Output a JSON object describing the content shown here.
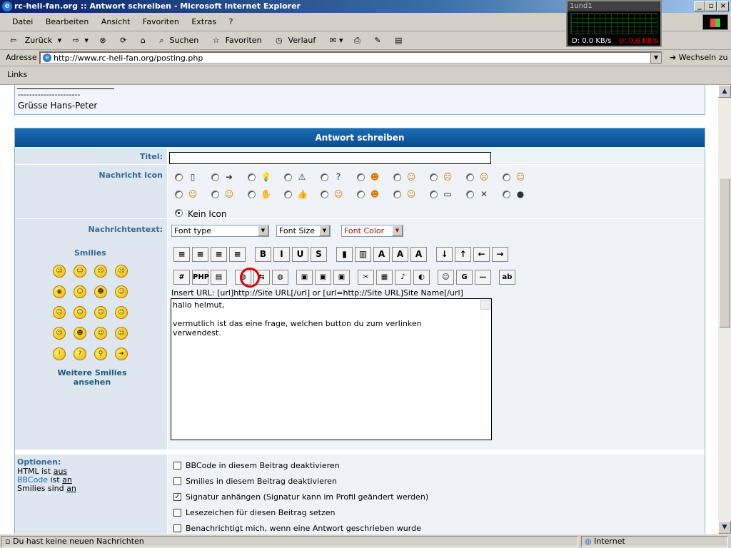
{
  "window": {
    "title": "rc-heli-fan.org :: Antwort schreiben - Microsoft Internet Explorer"
  },
  "net_meter": {
    "title": "1und1",
    "download": "D: 0,0 KB/s",
    "upload": "U: 0,0 KB/s"
  },
  "menu": [
    "Datei",
    "Bearbeiten",
    "Ansicht",
    "Favoriten",
    "Extras",
    "?"
  ],
  "toolbar": {
    "back": "Zurück",
    "search": "Suchen",
    "favorites": "Favoriten",
    "history": "Verlauf"
  },
  "address": {
    "label": "Adresse",
    "url": "http://www.rc-heli-fan.org/posting.php",
    "go": "Wechseln zu"
  },
  "links": {
    "label": "Links"
  },
  "post": {
    "divider": "----------------------",
    "greeting": "Grüsse Hans-Peter"
  },
  "form": {
    "header": "Antwort schreiben",
    "title_label": "Titel:",
    "icon_label": "Nachricht Icon",
    "no_icon": "Kein Icon",
    "text_label": "Nachrichtentext:",
    "font_type": "Font type",
    "font_size": "Font Size",
    "font_color": "Font Color",
    "smilies_heading": "Smilies",
    "more_smilies": "Weitere Smilies ansehen",
    "url_hint": "Insert URL: [url]http://Site URL[/url] or [url=http://Site URL]Site Name[/url]",
    "message": "hallo helmut,\n\nvermutlich ist das eine frage, welchen button du zum verlinken\nverwendest.\n",
    "options_heading": "Optionen:",
    "html_status": {
      "label": "HTML ist",
      "value": "aus"
    },
    "bbcode_status": {
      "label": "BBCode",
      "mid": "ist",
      "value": "an"
    },
    "smilies_status": {
      "label": "Smilies sind",
      "value": "an"
    },
    "checkboxes": [
      {
        "label": "BBCode in diesem Beitrag deaktivieren",
        "checked": false
      },
      {
        "label": "Smilies in diesem Beitrag deaktivieren",
        "checked": false
      },
      {
        "label": "Signatur anhängen (Signatur kann im Profil geändert werden)",
        "checked": true
      },
      {
        "label": "Lesezeichen für diesen Beitrag setzen",
        "checked": false
      },
      {
        "label": "Benachrichtigt mich, wenn eine Antwort geschrieben wurde",
        "checked": false
      }
    ]
  },
  "status": {
    "message": "Du hast keine neuen Nachrichten",
    "zone": "Internet"
  }
}
